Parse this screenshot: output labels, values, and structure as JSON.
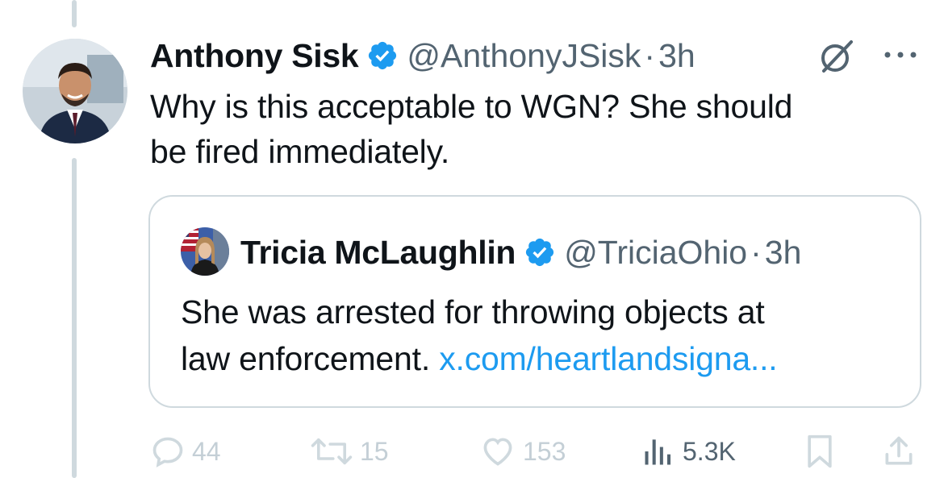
{
  "tweet": {
    "author_name": "Anthony Sisk",
    "author_handle": "@AnthonyJSisk",
    "separator": "·",
    "time": "3h",
    "text_line1": "Why is this acceptable to WGN? She should",
    "text_line2": "be fired immediately."
  },
  "quote": {
    "author_name": "Tricia McLaughlin",
    "author_handle": "@TriciaOhio",
    "separator": "·",
    "time": "3h",
    "text_line1": "She was arrested for throwing objects at",
    "text_line2_prefix": "law enforcement. ",
    "link_text": "x.com/heartlandsigna..."
  },
  "actions": {
    "replies": "44",
    "reposts": "15",
    "likes": "153",
    "views": "5.3K"
  },
  "icons": {
    "verified": "verified-badge-icon",
    "grok": "grok-icon",
    "more": "more-dots-icon",
    "reply": "reply-icon",
    "repost": "repost-icon",
    "like": "heart-icon",
    "views": "views-chart-icon",
    "bookmark": "bookmark-icon",
    "share": "share-icon"
  },
  "colors": {
    "text": "#0f1419",
    "secondary": "#536471",
    "link": "#1d9bf0",
    "verified": "#1d9bf0",
    "border": "#cfd9de",
    "faded_icon": "#cfd9de"
  }
}
